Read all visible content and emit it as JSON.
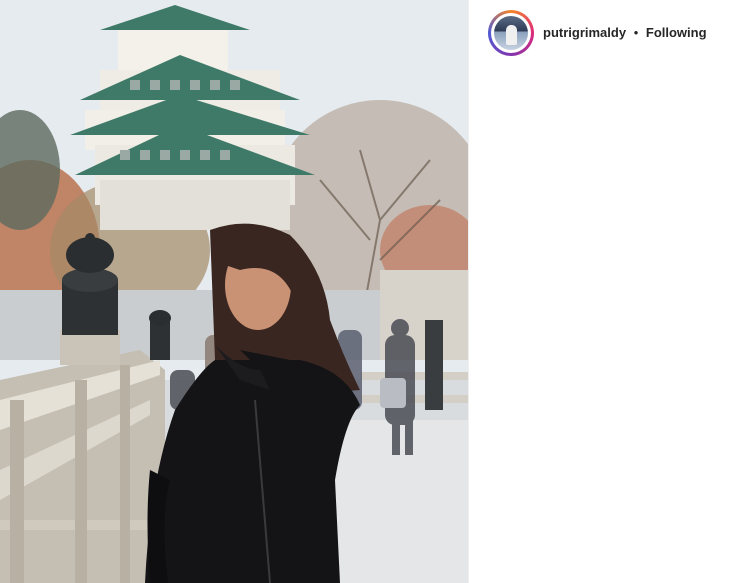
{
  "post": {
    "username": "putrigrimaldy",
    "separator": "•",
    "follow_status": "Following"
  },
  "icons": {
    "avatar": "profile-picture",
    "photo": "castle-portrait-photo"
  },
  "colors": {
    "text": "#262626",
    "divider": "#efefef",
    "ring_start": "#f58529",
    "ring_mid": "#dd2a7b",
    "ring_end": "#515bd4"
  }
}
